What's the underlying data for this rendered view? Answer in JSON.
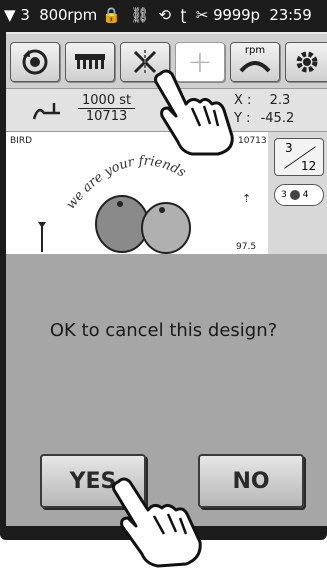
{
  "statusbar": {
    "needle_position": "3",
    "speed": "800rpm",
    "stitch_limit": "9999p",
    "clock": "23:59"
  },
  "toolbar": {
    "rpm_label": "rpm"
  },
  "infobar": {
    "current_stitch": "1000",
    "stitch_unit": "st",
    "total_stitches": "10713",
    "x_label": "X :",
    "x_value": "2.3",
    "y_label": "Y :",
    "y_value": "-45.2"
  },
  "preview": {
    "design_name": "BIRD",
    "stitch_count": "10713",
    "design_text": "we are your friends",
    "height_value": "97.5",
    "page_current": "3",
    "page_total": "12",
    "color_step": "3",
    "color_next": "4"
  },
  "dialog": {
    "message": "OK to cancel this design?",
    "yes_label": "YES",
    "no_label": "NO"
  }
}
